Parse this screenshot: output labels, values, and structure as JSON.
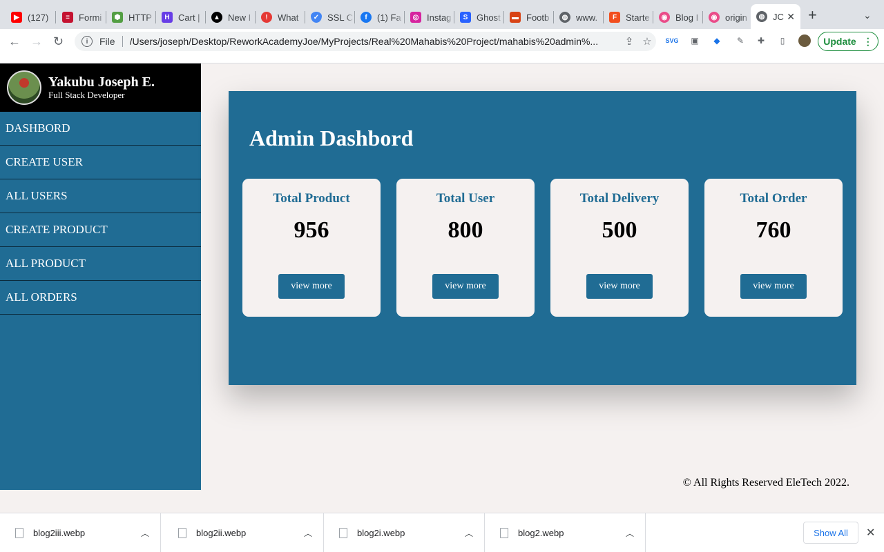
{
  "browser": {
    "tabs": [
      {
        "label": "(127)",
        "icon": "youtube-icon",
        "color": "#ff0000"
      },
      {
        "label": "Formi",
        "icon": "formik-icon",
        "color": "#c41230"
      },
      {
        "label": "HTTP",
        "icon": "nodejs-icon",
        "color": "#539e43"
      },
      {
        "label": "Cart |",
        "icon": "hostinger-icon",
        "color": "#673de6"
      },
      {
        "label": "New I",
        "icon": "vercel-icon",
        "color": "#000000"
      },
      {
        "label": "What",
        "icon": "alert-icon",
        "color": "#e53935"
      },
      {
        "label": "SSL C",
        "icon": "shield-icon",
        "color": "#4285f4"
      },
      {
        "label": "(1) Fa",
        "icon": "facebook-icon",
        "color": "#1877f2"
      },
      {
        "label": "Instag",
        "icon": "instagram-icon",
        "color": "#d6249f"
      },
      {
        "label": "Ghost",
        "icon": "ghost-icon",
        "color": "#2962ff"
      },
      {
        "label": "Footb",
        "icon": "football-icon",
        "color": "#d84315"
      },
      {
        "label": "www.",
        "icon": "globe-icon",
        "color": "#5f6368"
      },
      {
        "label": "Starte",
        "icon": "figma-icon",
        "color": "#f24e1e"
      },
      {
        "label": "Blog I",
        "icon": "dribbble-icon",
        "color": "#ea4c89"
      },
      {
        "label": "origin",
        "icon": "dribbble-icon",
        "color": "#ea4c89"
      },
      {
        "label": "JC",
        "icon": "globe-icon",
        "color": "#5f6368"
      }
    ],
    "url_scheme": "File",
    "url": "/Users/joseph/Desktop/ReworkAcademyJoe/MyProjects/Real%20Mahabis%20Project/mahabis%20admin%...",
    "update_label": "Update"
  },
  "profile": {
    "name": "Yakubu Joseph E.",
    "role": "Full Stack Developer"
  },
  "sidebar": {
    "items": [
      {
        "label": "DASHBORD"
      },
      {
        "label": "CREATE USER"
      },
      {
        "label": "ALL USERS"
      },
      {
        "label": "CREATE PRODUCT"
      },
      {
        "label": "ALL PRODUCT"
      },
      {
        "label": "ALL ORDERS"
      }
    ]
  },
  "dashboard": {
    "title": "Admin Dashbord",
    "cards": [
      {
        "label": "Total Product",
        "value": "956",
        "button": "view more"
      },
      {
        "label": "Total User",
        "value": "800",
        "button": "view more"
      },
      {
        "label": "Total Delivery",
        "value": "500",
        "button": "view more"
      },
      {
        "label": "Total Order",
        "value": "760",
        "button": "view more"
      }
    ]
  },
  "footer": {
    "text": "© All Rights Reserved EleTech 2022."
  },
  "downloads": {
    "items": [
      {
        "name": "blog2iii.webp"
      },
      {
        "name": "blog2ii.webp"
      },
      {
        "name": "blog2i.webp"
      },
      {
        "name": "blog2.webp"
      }
    ],
    "show_all_label": "Show All"
  },
  "colors": {
    "primary": "#206c94",
    "page_bg": "#f5f1f0",
    "card_bg": "#f5f1f0",
    "profile_bg": "#000000"
  }
}
